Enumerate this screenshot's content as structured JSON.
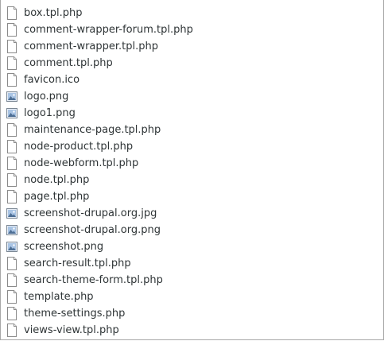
{
  "files": [
    {
      "name": "box.tpl.php",
      "icon": "text-file-icon"
    },
    {
      "name": "comment-wrapper-forum.tpl.php",
      "icon": "text-file-icon"
    },
    {
      "name": "comment-wrapper.tpl.php",
      "icon": "text-file-icon"
    },
    {
      "name": "comment.tpl.php",
      "icon": "text-file-icon"
    },
    {
      "name": "favicon.ico",
      "icon": "text-file-icon"
    },
    {
      "name": "logo.png",
      "icon": "image-file-icon"
    },
    {
      "name": "logo1.png",
      "icon": "image-file-icon"
    },
    {
      "name": "maintenance-page.tpl.php",
      "icon": "text-file-icon"
    },
    {
      "name": "node-product.tpl.php",
      "icon": "text-file-icon"
    },
    {
      "name": "node-webform.tpl.php",
      "icon": "text-file-icon"
    },
    {
      "name": "node.tpl.php",
      "icon": "text-file-icon"
    },
    {
      "name": "page.tpl.php",
      "icon": "text-file-icon"
    },
    {
      "name": "screenshot-drupal.org.jpg",
      "icon": "image-file-icon"
    },
    {
      "name": "screenshot-drupal.org.png",
      "icon": "image-file-icon"
    },
    {
      "name": "screenshot.png",
      "icon": "image-file-icon"
    },
    {
      "name": "search-result.tpl.php",
      "icon": "text-file-icon"
    },
    {
      "name": "search-theme-form.tpl.php",
      "icon": "text-file-icon"
    },
    {
      "name": "template.php",
      "icon": "text-file-icon"
    },
    {
      "name": "theme-settings.php",
      "icon": "text-file-icon"
    },
    {
      "name": "views-view.tpl.php",
      "icon": "text-file-icon"
    }
  ]
}
